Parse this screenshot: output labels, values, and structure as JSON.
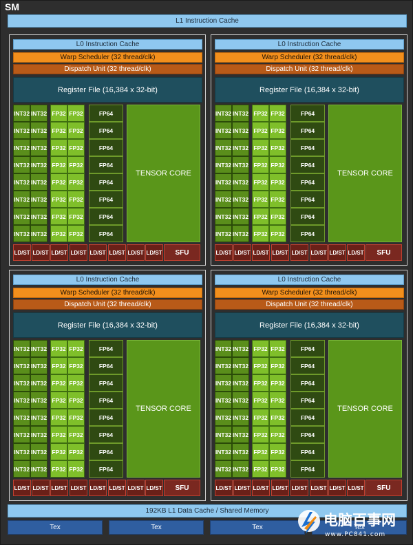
{
  "sm_title": "SM",
  "l1_instruction_cache": "L1 Instruction Cache",
  "partition": {
    "l0_instruction_cache": "L0 Instruction Cache",
    "warp_scheduler": "Warp Scheduler (32 thread/clk)",
    "dispatch_unit": "Dispatch Unit (32 thread/clk)",
    "register_file": "Register File (16,384 x 32-bit)",
    "int32": "INT32",
    "fp32": "FP32",
    "fp64": "FP64",
    "tensor_core": "TENSOR CORE",
    "ld_st_line1": "LD/",
    "ld_st_line2": "ST",
    "sfu": "SFU"
  },
  "l1_data_cache": "192KB L1 Data Cache / Shared Memory",
  "tex_label": "Tex",
  "watermark": {
    "brand": "电脑百事网",
    "url": "www.PC841.com"
  },
  "colors": {
    "sm_background": "#2e2e2e",
    "cache": "#8fc8ef",
    "warp_scheduler": "#f28f1c",
    "dispatch_unit": "#b85a18",
    "register_file": "#1f4f5e",
    "int32": "#5a8e1b",
    "fp32": "#7fbf2a",
    "fp64": "#2f4a12",
    "tensor_core": "#5a961a",
    "ld_st": "#6a2018",
    "tex": "#2f5ea0"
  }
}
